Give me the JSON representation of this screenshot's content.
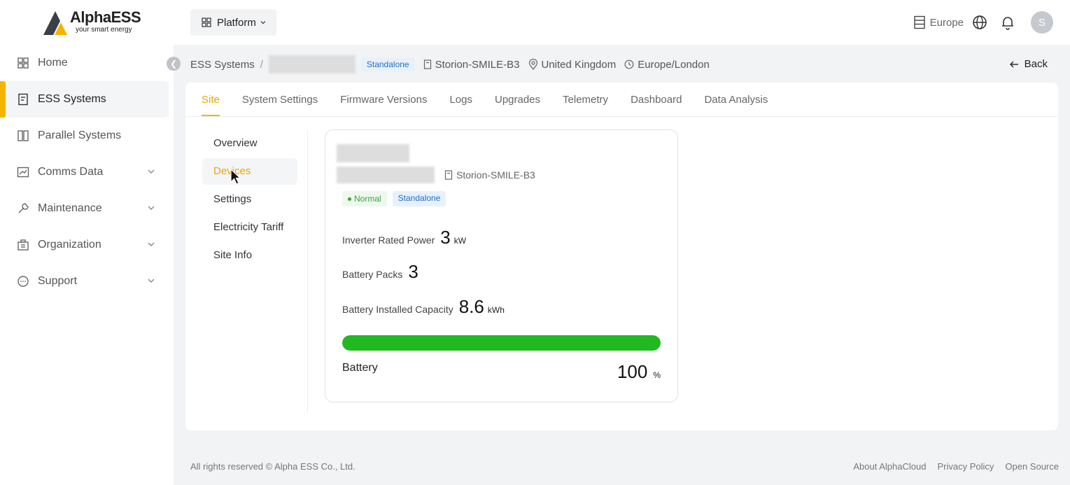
{
  "brand": {
    "name": "AlphaESS",
    "tagline": "your smart energy"
  },
  "sidebar": {
    "items": [
      {
        "label": "Home",
        "icon": "home-grid-icon"
      },
      {
        "label": "ESS Systems",
        "icon": "ess-building-icon",
        "active": true
      },
      {
        "label": "Parallel Systems",
        "icon": "parallel-icon"
      },
      {
        "label": "Comms Data",
        "icon": "chart-icon",
        "expandable": true
      },
      {
        "label": "Maintenance",
        "icon": "wrench-icon",
        "expandable": true
      },
      {
        "label": "Organization",
        "icon": "organization-icon",
        "expandable": true
      },
      {
        "label": "Support",
        "icon": "support-icon",
        "expandable": true
      }
    ]
  },
  "topbar": {
    "platform_label": "Platform",
    "region": "Europe",
    "avatar_initial": "S"
  },
  "breadcrumb": {
    "root": "ESS Systems",
    "separator": "/",
    "mode_tag": "Standalone",
    "model": "Storion-SMILE-B3",
    "country": "United Kingdom",
    "timezone": "Europe/London",
    "back_label": "Back"
  },
  "tabs": [
    "Site",
    "System Settings",
    "Firmware Versions",
    "Logs",
    "Upgrades",
    "Telemetry",
    "Dashboard",
    "Data Analysis"
  ],
  "active_tab": "Site",
  "subnav": [
    "Overview",
    "Devices",
    "Settings",
    "Electricity Tariff",
    "Site Info"
  ],
  "active_subnav": "Devices",
  "device": {
    "model": "Storion-SMILE-B3",
    "status": "Normal",
    "mode": "Standalone",
    "inverter_label": "Inverter Rated Power",
    "inverter_value": "3",
    "inverter_unit": "kW",
    "packs_label": "Battery Packs",
    "packs_value": "3",
    "capacity_label": "Battery Installed Capacity",
    "capacity_value": "8.6",
    "capacity_unit": "kWh",
    "battery_label": "Battery",
    "battery_value": "100",
    "battery_unit": "%",
    "battery_fraction": 1.0
  },
  "colors": {
    "accent": "#f5b400",
    "battery_green": "#22b822",
    "tag_blue": "#1f6fc5",
    "status_green": "#3aa23a"
  },
  "footer": {
    "copyright": "All rights reserved © Alpha ESS Co., Ltd.",
    "links": [
      "About AlphaCloud",
      "Privacy Policy",
      "Open Source"
    ]
  }
}
